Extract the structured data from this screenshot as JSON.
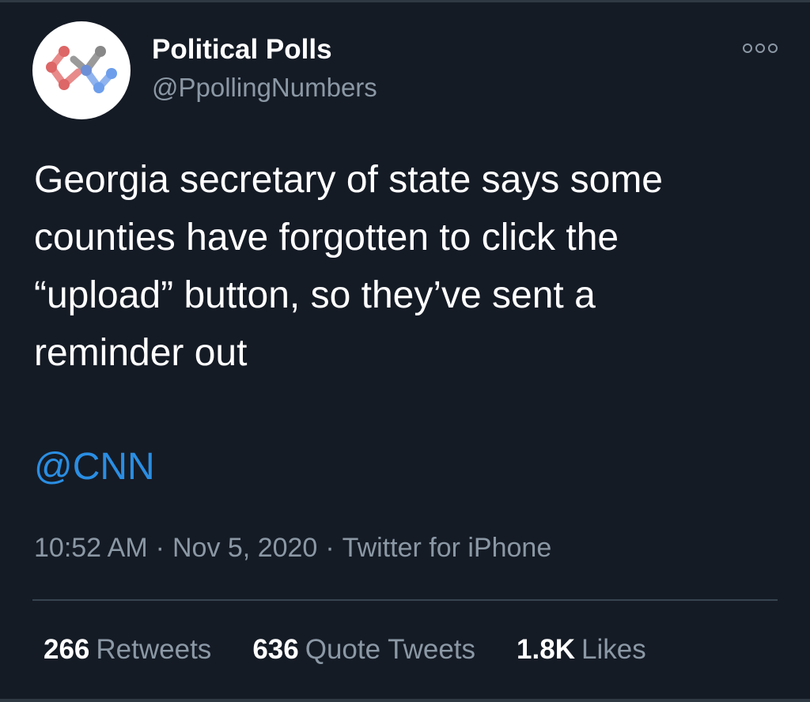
{
  "author": {
    "display_name": "Political Polls",
    "handle": "@PpollingNumbers",
    "avatar_icon": "polls-logo-icon"
  },
  "tweet": {
    "text": "Georgia secretary of state says some\ncounties have forgotten to click the\n“upload” button, so they’ve sent a\nreminder out",
    "mention": "@CNN"
  },
  "meta": {
    "time": "10:52 AM",
    "date": "Nov 5, 2020",
    "source": "Twitter for iPhone",
    "separator": "·"
  },
  "stats": [
    {
      "count": "266",
      "label": "Retweets"
    },
    {
      "count": "636",
      "label": "Quote Tweets"
    },
    {
      "count": "1.8K",
      "label": "Likes"
    }
  ],
  "colors": {
    "background": "#151b25",
    "text_primary": "#ffffff",
    "text_secondary": "#8b98a5",
    "link": "#2a8ee3",
    "divider": "#37444f",
    "logo_red": "#e06666",
    "logo_blue": "#6d9eeb",
    "logo_gray": "#8c8c8c"
  },
  "icons": {
    "more": "more-options-icon"
  }
}
